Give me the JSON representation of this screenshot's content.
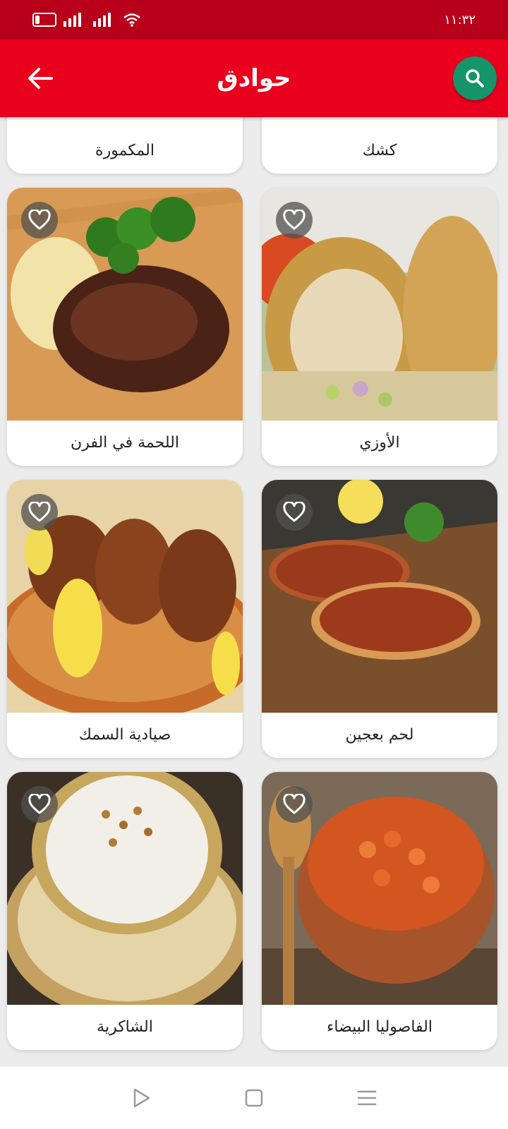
{
  "status_bar": {
    "time": "١١:٣٢",
    "battery": "٩"
  },
  "app_bar": {
    "title": "حوادق"
  },
  "recipes": [
    {
      "title": "كشك"
    },
    {
      "title": "المكمورة"
    },
    {
      "title": "الأوزي"
    },
    {
      "title": "اللحمة في الفرن"
    },
    {
      "title": "لحم بعجين"
    },
    {
      "title": "صيادية السمك"
    },
    {
      "title": "الفاصوليا البيضاء"
    },
    {
      "title": "الشاكرية"
    }
  ],
  "colors": {
    "status_bar": "#b8001a",
    "app_bar": "#e8001c",
    "search_fab": "#16946a"
  },
  "icons": [
    "back-arrow-icon",
    "search-icon",
    "heart-outline-icon",
    "play-triangle-icon",
    "square-icon",
    "menu-lines-icon"
  ]
}
